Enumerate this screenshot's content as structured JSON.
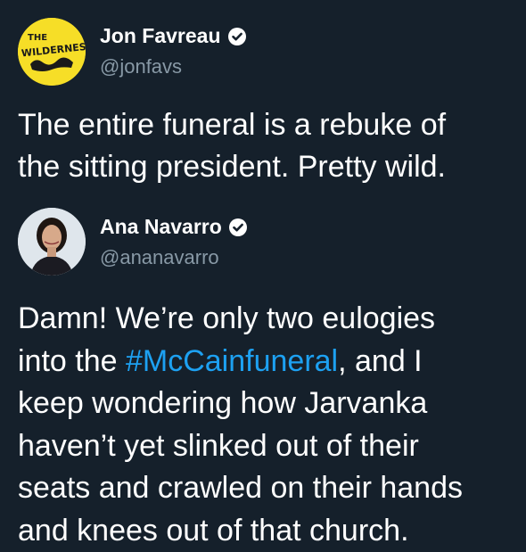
{
  "tweets": [
    {
      "author": {
        "name": "Jon Favreau",
        "handle": "@jonfavs",
        "verified": true,
        "avatar_text_1": "THE",
        "avatar_text_2": "WILDERNESS"
      },
      "lines": [
        "The entire funeral is a rebuke of",
        "the sitting president. Pretty wild."
      ]
    },
    {
      "author": {
        "name": "Ana Navarro",
        "handle": "@ananavarro",
        "verified": true
      },
      "lines": [
        "Damn! We’re only two eulogies",
        "into the ",
        "#McCainfuneral",
        ", and I",
        "keep wondering how Jarvanka",
        "haven’t yet slinked out of their",
        "seats and crawled on their hands",
        "and knees out of that church."
      ]
    }
  ],
  "colors": {
    "background": "#15202b",
    "text": "#ffffff",
    "secondary_text": "#8899a6",
    "link": "#1da1f2",
    "avatar_yellow": "#f6de27"
  },
  "icons": [
    "verified-badge-icon"
  ]
}
